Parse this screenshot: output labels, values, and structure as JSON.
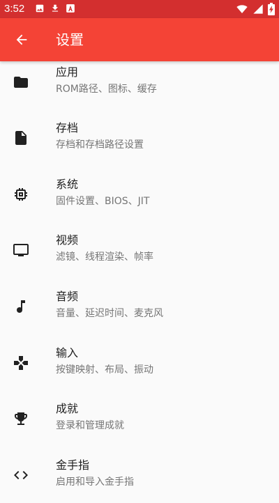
{
  "status_bar": {
    "time": "3:52",
    "left_icons": [
      "image-icon",
      "download-icon",
      "app-a-icon"
    ],
    "right_icons": [
      "wifi-icon",
      "signal-icon",
      "battery-charging-icon"
    ],
    "background": "#d32f2f"
  },
  "appbar": {
    "title": "设置",
    "back_icon": "arrow-back-icon",
    "background": "#f44336"
  },
  "settings": [
    {
      "icon": "folder-icon",
      "title": "应用",
      "subtitle": "ROM路径、图标、缓存"
    },
    {
      "icon": "document-icon",
      "title": "存档",
      "subtitle": "存档和存档路径设置"
    },
    {
      "icon": "chip-icon",
      "title": "系统",
      "subtitle": "固件设置、BIOS、JIT"
    },
    {
      "icon": "tv-icon",
      "title": "视频",
      "subtitle": "滤镜、线程渲染、帧率"
    },
    {
      "icon": "music-note-icon",
      "title": "音频",
      "subtitle": "音量、延迟时间、麦克风"
    },
    {
      "icon": "gamepad-icon",
      "title": "输入",
      "subtitle": "按键映射、布局、振动"
    },
    {
      "icon": "trophy-icon",
      "title": "成就",
      "subtitle": "登录和管理成就"
    },
    {
      "icon": "code-icon",
      "title": "金手指",
      "subtitle": "启用和导入金手指"
    }
  ]
}
